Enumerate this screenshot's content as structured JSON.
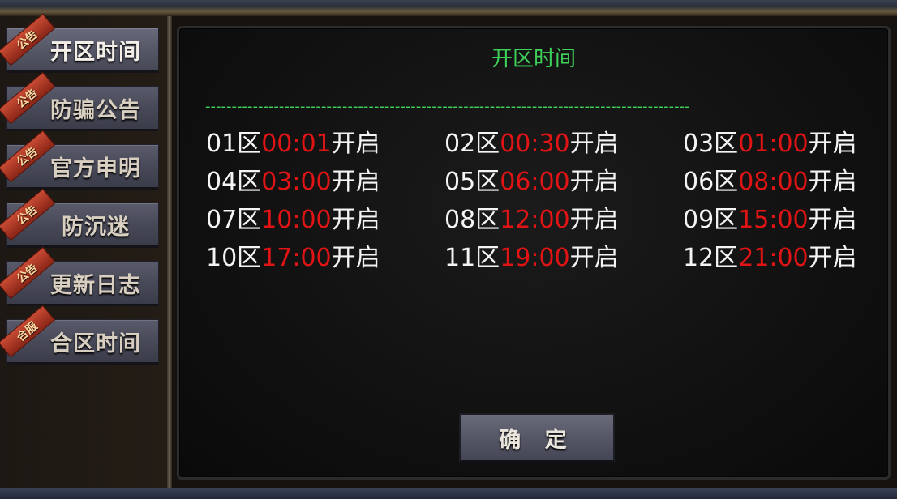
{
  "sidebar": {
    "tabs": [
      {
        "badge": "公告",
        "label": "开区时间"
      },
      {
        "badge": "公告",
        "label": "防骗公告"
      },
      {
        "badge": "公告",
        "label": "官方申明"
      },
      {
        "badge": "公告",
        "label": "防沉迷"
      },
      {
        "badge": "公告",
        "label": "更新日志"
      },
      {
        "badge": "合服",
        "label": "合区时间"
      }
    ],
    "active_tab": "开区时间"
  },
  "panel": {
    "title": "开区时间",
    "separator": "--------------------------------------------------------------------------------------------",
    "open_word": "开启",
    "entries": [
      {
        "zone": "01区",
        "time": "00:01"
      },
      {
        "zone": "02区",
        "time": "00:30"
      },
      {
        "zone": "03区",
        "time": "01:00"
      },
      {
        "zone": "04区",
        "time": "03:00"
      },
      {
        "zone": "05区",
        "time": "06:00"
      },
      {
        "zone": "06区",
        "time": "08:00"
      },
      {
        "zone": "07区",
        "time": "10:00"
      },
      {
        "zone": "08区",
        "time": "12:00"
      },
      {
        "zone": "09区",
        "time": "15:00"
      },
      {
        "zone": "10区",
        "time": "17:00"
      },
      {
        "zone": "11区",
        "time": "19:00"
      },
      {
        "zone": "12区",
        "time": "21:00"
      }
    ],
    "confirm_label": "确 定"
  },
  "colors": {
    "title_green": "#3fd25a",
    "time_red": "#e01414",
    "text_white": "#f4f4f4"
  }
}
